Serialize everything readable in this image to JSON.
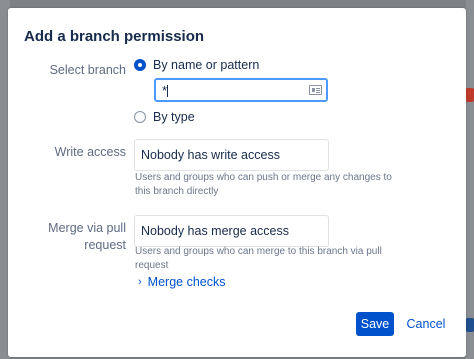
{
  "dialog": {
    "title": "Add a branch permission",
    "select_branch": {
      "label": "Select branch",
      "option_name": "By name or pattern",
      "option_type": "By type",
      "pattern_value": "*"
    },
    "write_access": {
      "label": "Write access",
      "value": "Nobody has write access",
      "help": "Users and groups who can push or merge any changes to this branch directly"
    },
    "merge_access": {
      "label": "Merge via pull request",
      "value": "Nobody has merge access",
      "help": "Users and groups who can merge to this branch via pull request"
    },
    "merge_checks": "Merge checks",
    "save_label": "Save",
    "cancel_label": "Cancel"
  },
  "colors": {
    "primary": "#0052cc",
    "focus": "#4c9aff",
    "text": "#172b4d",
    "muted": "#5e6c84",
    "overlay": "#7d8085"
  },
  "icons": {
    "pattern_picker": "branch-pattern-icon",
    "expand": "chevron-right-icon"
  }
}
